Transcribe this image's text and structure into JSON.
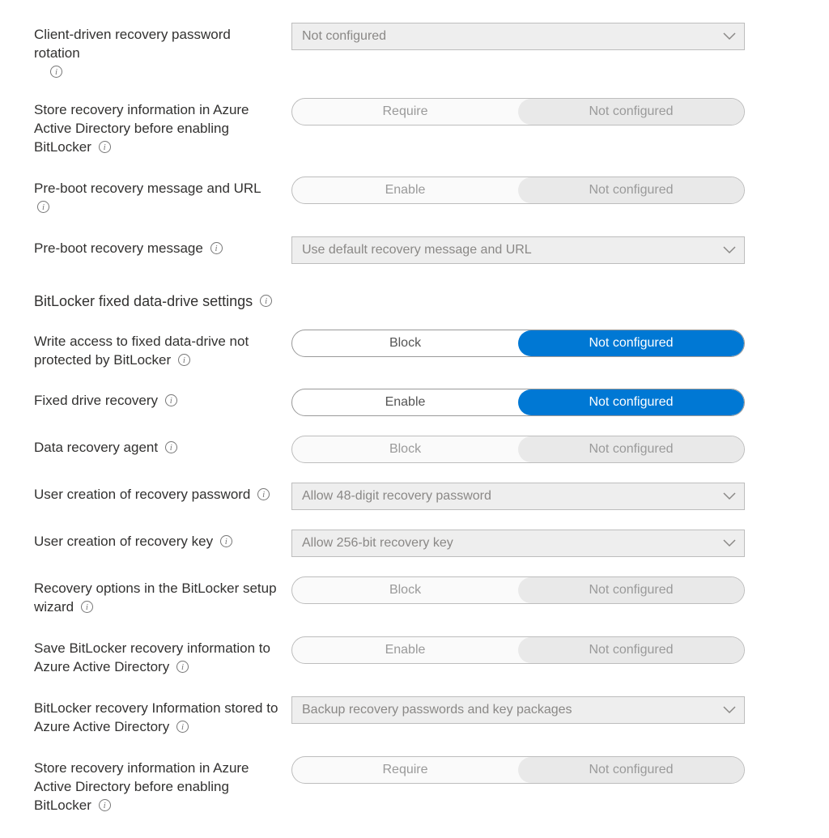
{
  "common": {
    "not_configured": "Not configured",
    "require": "Require",
    "enable": "Enable",
    "block": "Block"
  },
  "rows": {
    "client_rotation": {
      "label": "Client-driven recovery password rotation",
      "select_value": "Not configured"
    },
    "store_aad_before_1": {
      "label": "Store recovery information in Azure Active Directory before enabling BitLocker"
    },
    "preboot_msg_url": {
      "label": "Pre-boot recovery message and URL"
    },
    "preboot_msg": {
      "label": "Pre-boot recovery message",
      "select_value": "Use default recovery message and URL"
    },
    "fixed_write_access": {
      "label": "Write access to fixed data-drive not protected by BitLocker"
    },
    "fixed_recovery": {
      "label": "Fixed drive recovery"
    },
    "data_recovery_agent": {
      "label": "Data recovery agent"
    },
    "user_recovery_password": {
      "label": "User creation of recovery password",
      "select_value": "Allow 48-digit recovery password"
    },
    "user_recovery_key": {
      "label": "User creation of recovery key",
      "select_value": "Allow 256-bit recovery key"
    },
    "recovery_options_wizard": {
      "label": "Recovery options in the BitLocker setup wizard"
    },
    "save_to_aad": {
      "label": "Save BitLocker recovery information to Azure Active Directory"
    },
    "info_stored_aad": {
      "label": "BitLocker recovery Information stored to Azure Active Directory",
      "select_value": "Backup recovery passwords and key packages"
    },
    "store_aad_before_2": {
      "label": "Store recovery information in Azure Active Directory before enabling BitLocker"
    }
  },
  "section": {
    "fixed_header": "BitLocker fixed data-drive settings"
  }
}
